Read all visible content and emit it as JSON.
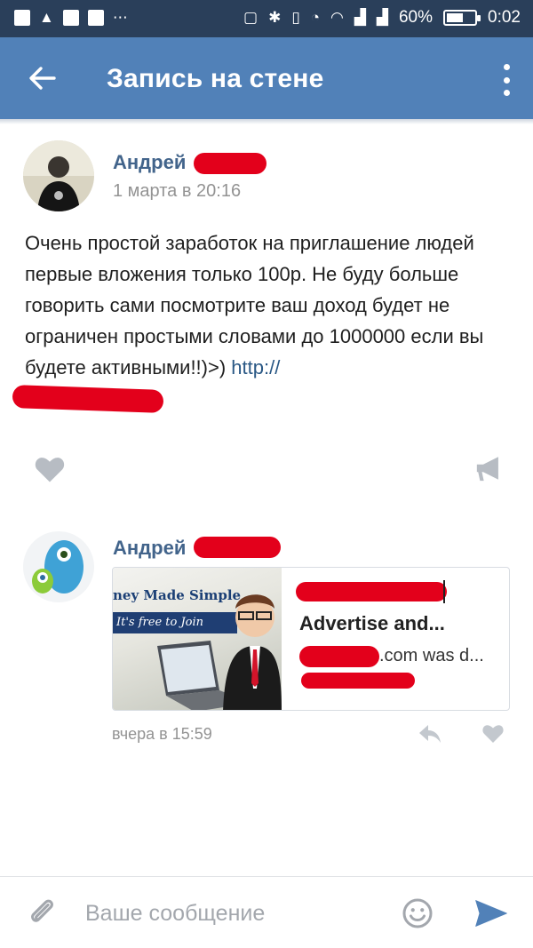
{
  "status_bar": {
    "battery": "60%",
    "time": "0:02",
    "battery_level": 0.6
  },
  "app_bar": {
    "title": "Запись на стене"
  },
  "post": {
    "author": "Андрей",
    "date": "1 марта в 20:16",
    "text": "Очень простой заработок на приглашение людей первые вложения только 100р. Не буду больше говорить сами посмотрите ваш доход будет не ограничен простыми словами до 1000000 если вы будете активными!!)>) ",
    "link_text": "http://"
  },
  "comment": {
    "author": "Андрей",
    "card": {
      "image_line1": "ney Made Simple",
      "image_line2": "It's free to Join",
      "title": "Advertise and...",
      "description": ".com was d..."
    },
    "date": "вчера в 15:59"
  },
  "composer": {
    "placeholder": "Ваше сообщение"
  },
  "colors": {
    "app_bar": "#5181b8",
    "status_bar": "#2a3f5a",
    "link": "#2a5885",
    "author": "#42648b",
    "muted": "#939393",
    "redaction": "#e3001b"
  }
}
